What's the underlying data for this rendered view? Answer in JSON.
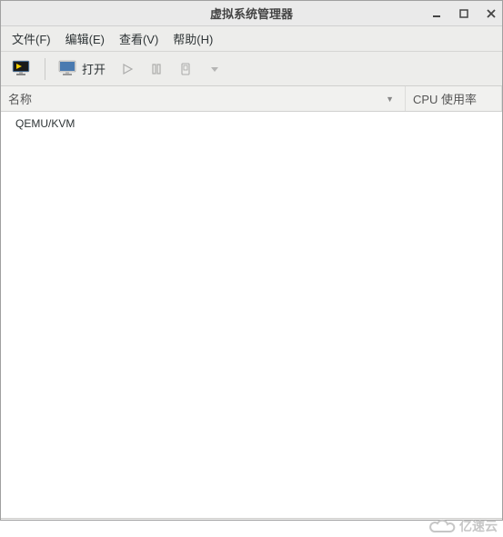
{
  "window": {
    "title": "虚拟系统管理器"
  },
  "menu": {
    "file": "文件(F)",
    "edit": "编辑(E)",
    "view": "查看(V)",
    "help": "帮助(H)"
  },
  "toolbar": {
    "open_label": "打开"
  },
  "columns": {
    "name": "名称",
    "cpu": "CPU 使用率"
  },
  "list": {
    "items": [
      {
        "label": "QEMU/KVM"
      }
    ]
  },
  "watermark": {
    "text": "亿速云"
  }
}
